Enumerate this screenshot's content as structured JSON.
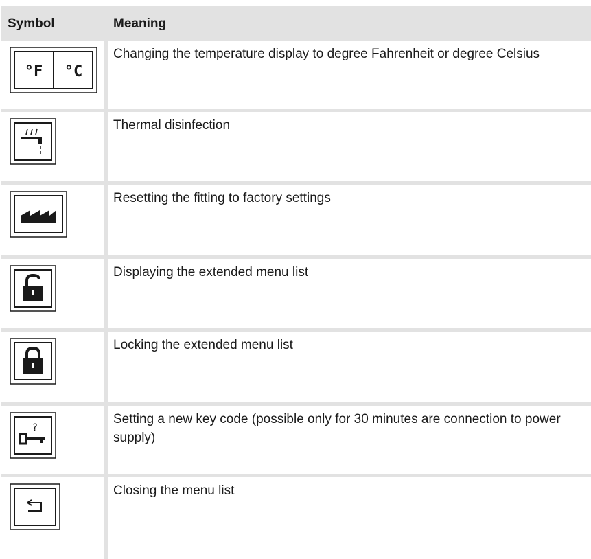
{
  "table": {
    "headers": {
      "symbol": "Symbol",
      "meaning": "Meaning"
    },
    "rows": [
      {
        "icon": "fahrenheit-celsius-icon",
        "meaning": "Changing the temperature display to degree Fahrenheit or degree Celsius"
      },
      {
        "icon": "thermal-disinfection-icon",
        "meaning": "Thermal disinfection"
      },
      {
        "icon": "factory-icon",
        "meaning": "Resetting the fitting to factory settings"
      },
      {
        "icon": "unlocked-padlock-icon",
        "meaning": "Displaying the extended menu list"
      },
      {
        "icon": "locked-padlock-icon",
        "meaning": "Locking the extended menu list"
      },
      {
        "icon": "key-question-icon",
        "meaning": "Setting a new key code (possible only for 30 minutes are connection to power supply)"
      },
      {
        "icon": "return-arrow-icon",
        "meaning": "Closing the menu list"
      }
    ],
    "icon_glyphs": {
      "fahrenheit": "°F",
      "celsius": "°C",
      "question": "?"
    }
  }
}
